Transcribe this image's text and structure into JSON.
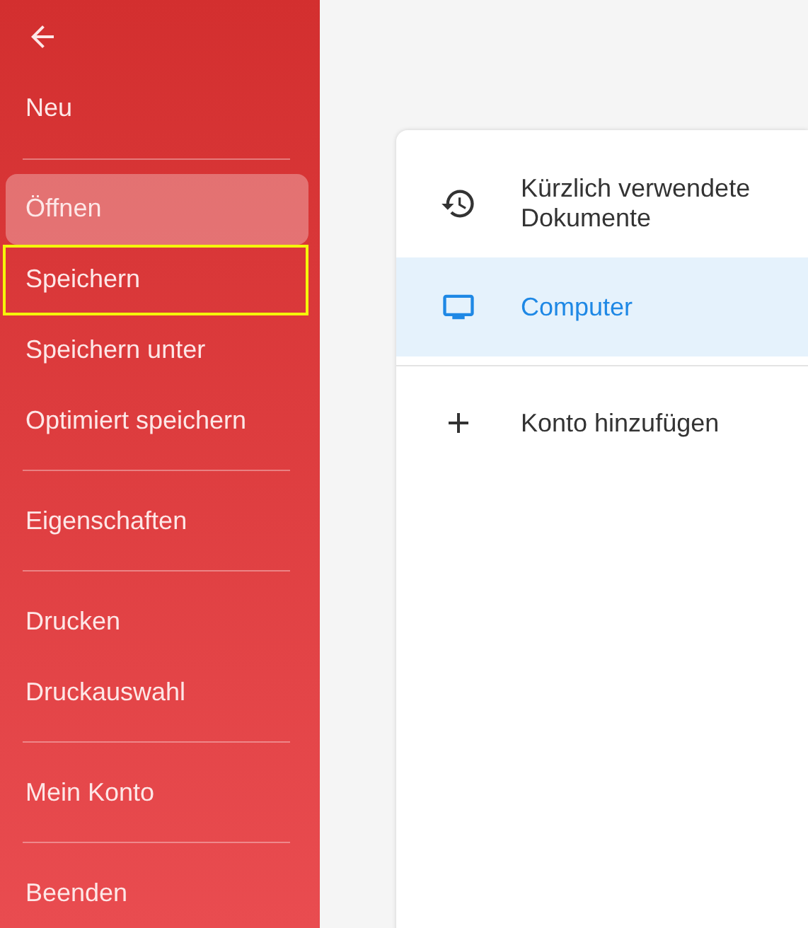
{
  "back_button": {
    "kind": "back"
  },
  "menu_groups": [
    {
      "items": [
        {
          "label": "Neu",
          "selected": false,
          "focused": false
        }
      ]
    },
    {
      "items": [
        {
          "label": "Öffnen",
          "selected": true,
          "focused": false
        },
        {
          "label": "Speichern",
          "selected": false,
          "focused": true
        },
        {
          "label": "Speichern unter",
          "selected": false,
          "focused": false
        },
        {
          "label": "Optimiert speichern",
          "selected": false,
          "focused": false
        }
      ]
    },
    {
      "items": [
        {
          "label": "Eigenschaften",
          "selected": false,
          "focused": false
        }
      ]
    },
    {
      "items": [
        {
          "label": "Drucken",
          "selected": false,
          "focused": false
        },
        {
          "label": "Druckauswahl",
          "selected": false,
          "focused": false
        }
      ]
    },
    {
      "items": [
        {
          "label": "Mein Konto",
          "selected": false,
          "focused": false
        }
      ]
    },
    {
      "items": [
        {
          "label": "Beenden",
          "selected": false,
          "focused": false
        }
      ]
    }
  ],
  "locations": [
    {
      "kind": "history",
      "label": "Kürzlich verwendete Dokumente",
      "selected": false
    },
    {
      "kind": "computer",
      "label": "Computer",
      "selected": true
    }
  ],
  "add_account": {
    "kind": "plus",
    "label": "Konto hinzufügen"
  }
}
